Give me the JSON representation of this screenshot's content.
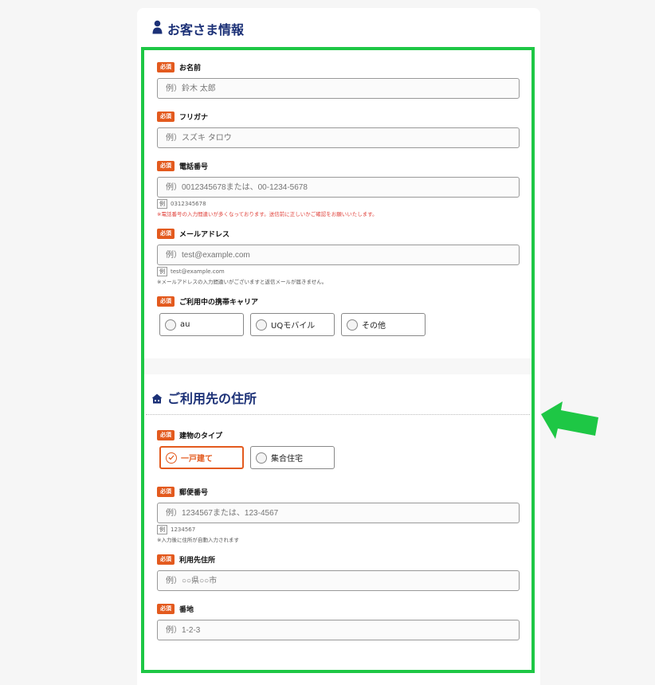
{
  "section_customer": {
    "title": "お客さま情報",
    "icon": "person-icon"
  },
  "section_address": {
    "title": "ご利用先の住所",
    "icon": "house-icon"
  },
  "required_label": "必須",
  "example_label": "例",
  "fields": {
    "name": {
      "label": "お名前",
      "placeholder": "例）鈴木 太郎"
    },
    "kana": {
      "label": "フリガナ",
      "placeholder": "例）スズキ タロウ"
    },
    "phone": {
      "label": "電話番号",
      "placeholder": "例）0012345678または、00-1234-5678",
      "example": "0312345678",
      "note": "※電話番号の入力間違いが多くなっております。送信前に正しいかご確認をお願いいたします。"
    },
    "email": {
      "label": "メールアドレス",
      "placeholder": "例）test@example.com",
      "example": "test@example.com",
      "note": "※メールアドレスの入力間違いがございますと返信メールが届きません。"
    },
    "carrier": {
      "label": "ご利用中の携帯キャリア",
      "options": [
        "au",
        "UQモバイル",
        "その他"
      ]
    },
    "building": {
      "label": "建物のタイプ",
      "options": [
        "一戸建て",
        "集合住宅"
      ],
      "selected": "一戸建て"
    },
    "postal": {
      "label": "郵便番号",
      "placeholder": "例）1234567または、123-4567",
      "example": "1234567",
      "note": "※入力後に住所が自動入力されます"
    },
    "address": {
      "label": "利用先住所",
      "placeholder": "例）○○県○○市"
    },
    "street": {
      "label": "番地",
      "placeholder": "例）1-2-3"
    }
  },
  "colors": {
    "accent": "#e35a1e",
    "title": "#1c3177",
    "highlight": "#1ec745"
  }
}
